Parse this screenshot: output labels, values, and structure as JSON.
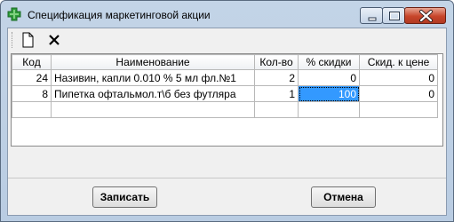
{
  "window": {
    "title": "Спецификация маркетинговой акции"
  },
  "toolbar": {
    "buttons": [
      {
        "icon": "new-document-icon"
      },
      {
        "icon": "delete-icon"
      }
    ]
  },
  "grid": {
    "columns": [
      "Код",
      "Наименование",
      "Кол-во",
      "% скидки",
      "Скид. к цене"
    ],
    "rows": [
      {
        "code": "24",
        "name": "Називин, капли 0.010 % 5 мл фл.№1",
        "qty": "2",
        "discount_pct": "0",
        "price_discount": "0"
      },
      {
        "code": "8",
        "name": "Пипетка офтальмол.т\\б без футляра",
        "qty": "1",
        "discount_pct": "100",
        "price_discount": "0"
      }
    ],
    "selected_cell": {
      "row": 1,
      "column": "% скидки"
    }
  },
  "actions": {
    "save_label": "Записать",
    "cancel_label": "Отмена"
  },
  "colors": {
    "selection": "#3399ff",
    "close_button": "#c7452a",
    "app_icon": "#2e9b3a"
  }
}
